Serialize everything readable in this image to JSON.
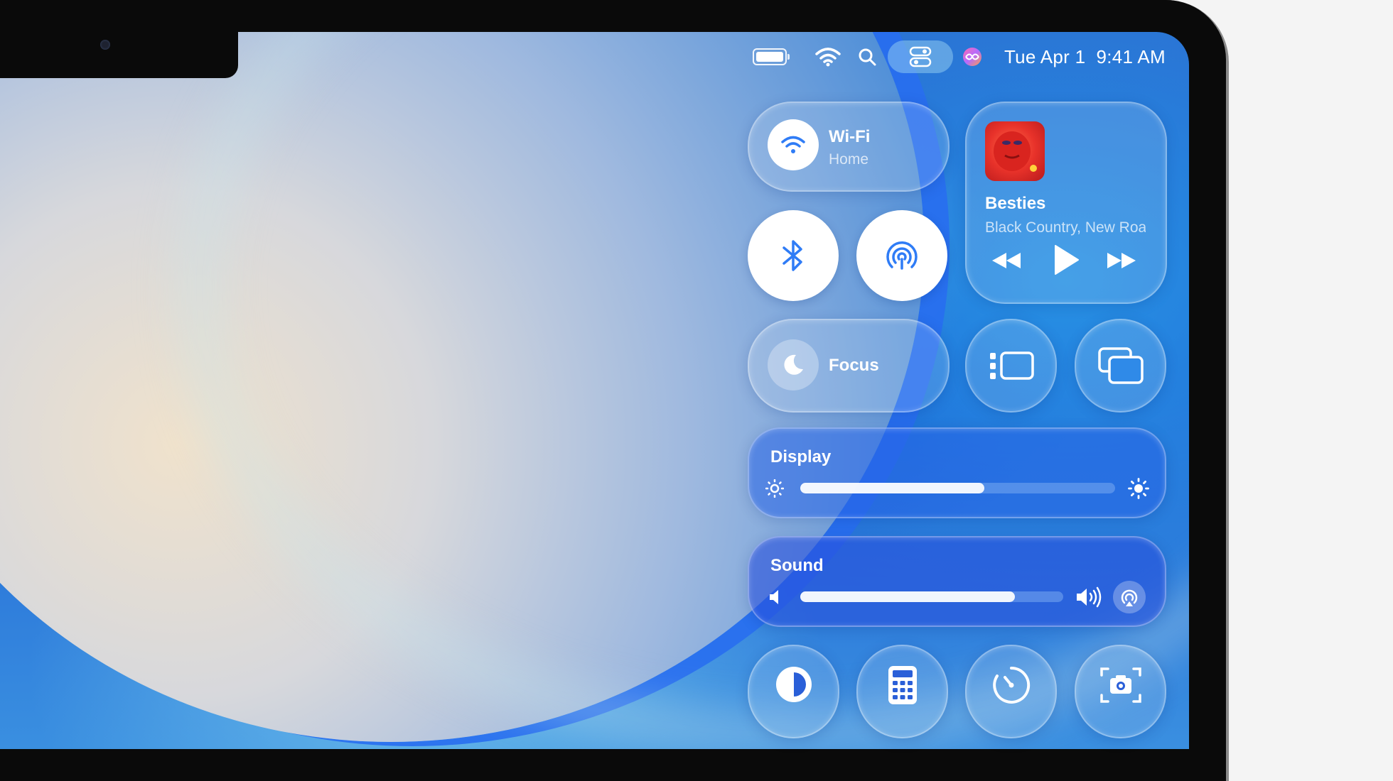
{
  "menubar": {
    "battery_icon": "battery-icon",
    "wifi_icon": "wifi-icon",
    "search_icon": "search-icon",
    "control_center_icon": "control-center-icon",
    "siri_icon": "siri-icon",
    "date": "Tue Apr 1",
    "time": "9:41 AM"
  },
  "control_center": {
    "wifi": {
      "label": "Wi-Fi",
      "network": "Home",
      "icon": "wifi-icon"
    },
    "bluetooth": {
      "icon": "bluetooth-icon"
    },
    "airdrop": {
      "icon": "airdrop-icon"
    },
    "now_playing": {
      "title": "Besties",
      "artist": "Black Country, New Road",
      "artwork_colors": [
        "#e8322a",
        "#c71d1f"
      ],
      "controls": [
        "rewind-icon",
        "play-icon",
        "fast-forward-icon"
      ]
    },
    "focus": {
      "label": "Focus",
      "icon": "moon-icon"
    },
    "stage_manager": {
      "icon": "stage-manager-icon"
    },
    "screen_mirroring": {
      "icon": "screen-mirroring-icon"
    },
    "display": {
      "label": "Display",
      "brightness_fraction": 0.585
    },
    "sound": {
      "label": "Sound",
      "volume_fraction": 0.815
    },
    "bottom_row": [
      "dark-mode-icon",
      "calculator-icon",
      "timer-icon",
      "screenshot-icon"
    ]
  },
  "colors": {
    "accent": "#2f7cf6",
    "panel_glass": "rgba(255,255,255,0.14)"
  }
}
